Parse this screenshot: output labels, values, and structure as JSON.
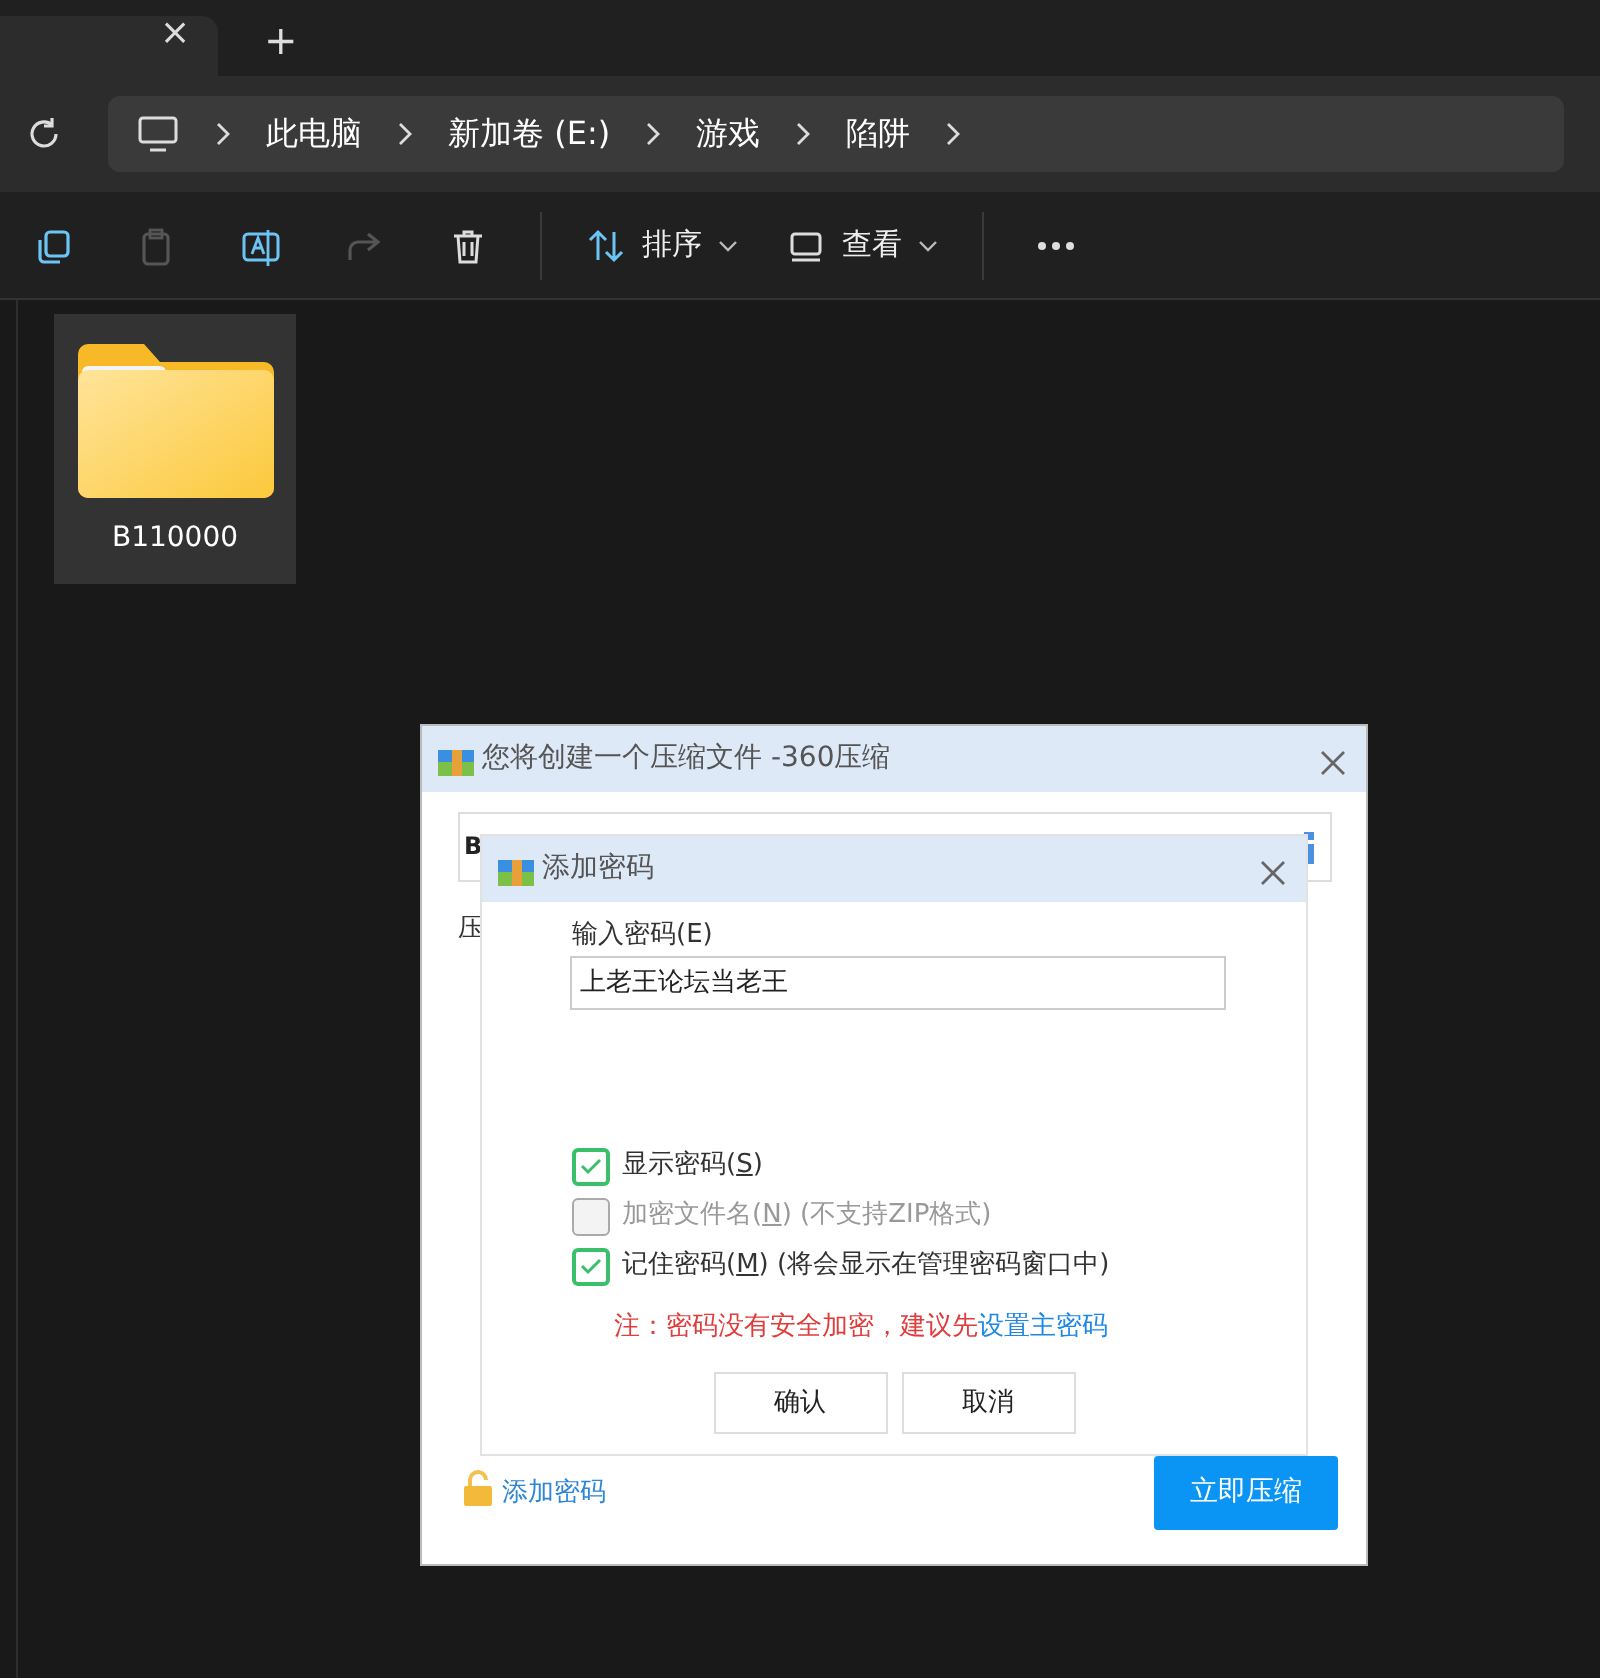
{
  "explorer": {
    "tab": {
      "close": "×"
    },
    "new_tab": "+",
    "breadcrumbs": [
      "此电脑",
      "新加卷 (E:)",
      "游戏",
      "陷阱"
    ],
    "toolbar": [
      {
        "kind": "copy",
        "disabled": false
      },
      {
        "kind": "paste",
        "disabled": true
      },
      {
        "kind": "rename",
        "disabled": false
      },
      {
        "kind": "share",
        "disabled": true
      },
      {
        "kind": "delete",
        "disabled": false
      },
      {
        "kind": "sort",
        "label": "排序",
        "disabled": false
      },
      {
        "kind": "view",
        "label": "查看",
        "disabled": false
      },
      {
        "kind": "more",
        "disabled": false
      }
    ],
    "files": [
      {
        "name": "B110000",
        "selected": true
      }
    ]
  },
  "compress_dialog": {
    "title": "您将创建一个压缩文件 -360压缩",
    "field_text": "B",
    "label_text": "压",
    "add_password_link": "添加密码",
    "compress_button": "立即压缩"
  },
  "password_dialog": {
    "title": "添加密码",
    "field_label": "输入密码(E)",
    "password": "上老王论坛当老王",
    "options": [
      {
        "before": "显示密码(",
        "key": "S",
        "after": ")",
        "checked": true,
        "disabled": false
      },
      {
        "before": "加密文件名(",
        "key": "N",
        "after": ") (不支持ZIP格式)",
        "checked": false,
        "disabled": true
      },
      {
        "before": "记住密码(",
        "key": "M",
        "after": ") (将会显示在管理密码窗口中)",
        "checked": true,
        "disabled": false
      }
    ],
    "note": "注：密码没有安全加密，建议先",
    "note_link": "设置主密码",
    "buttons": [
      "确认",
      "取消"
    ]
  }
}
